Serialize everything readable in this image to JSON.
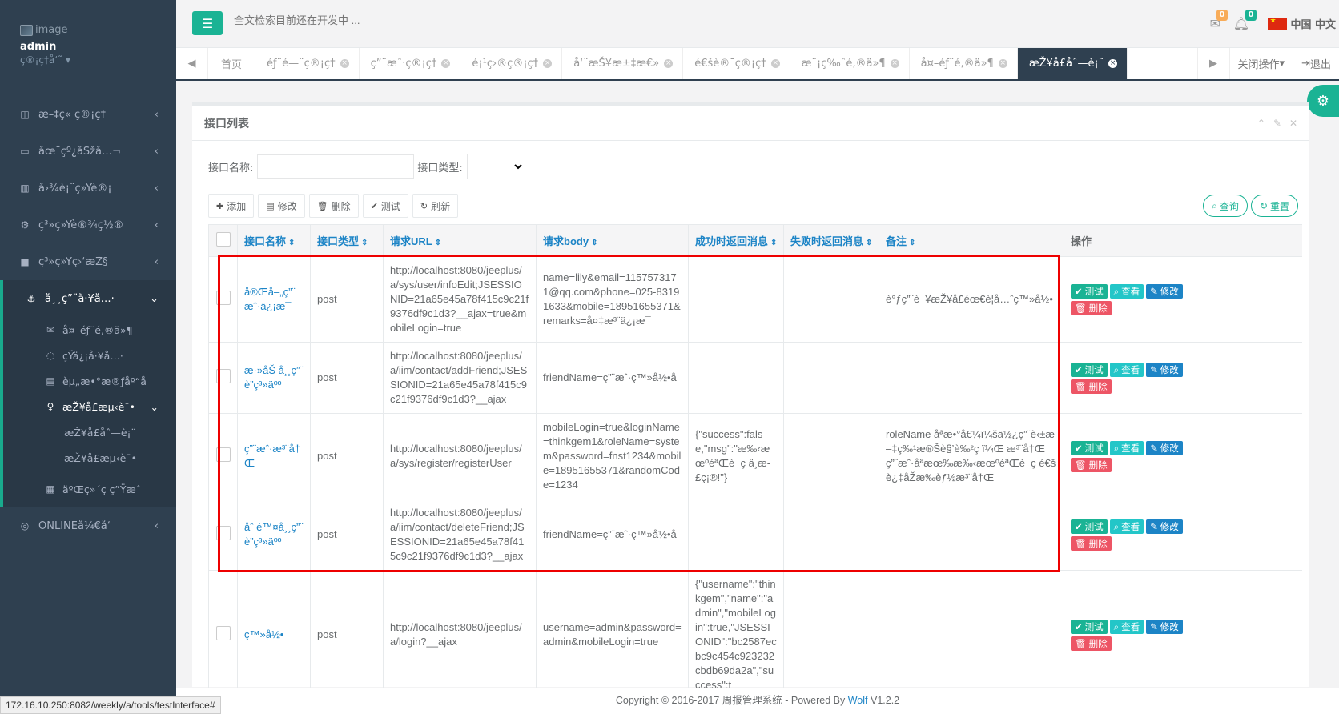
{
  "sidebar": {
    "profile": {
      "image_alt": "image",
      "name": "admin",
      "role": "ç®¡ç†å‘˜"
    },
    "items": [
      {
        "icon": "columns-icon",
        "glyph": "◫",
        "label": "æ–‡ç« ç®¡ç†"
      },
      {
        "icon": "desktop-icon",
        "glyph": "▭",
        "label": "åœ¨çº¿åŠžå…¬"
      },
      {
        "icon": "bar-chart-icon",
        "glyph": "▥",
        "label": "å›¾è¡¨ç»Ÿè®¡"
      },
      {
        "icon": "gear-icon",
        "glyph": "⚙",
        "label": "ç³»ç»Ÿè®¾ç½®"
      },
      {
        "icon": "video-icon",
        "glyph": "■",
        "label": "ç³»ç»Ÿç›‘æŽ§"
      }
    ],
    "open_group": {
      "icon": "anchor-icon",
      "glyph": "⚓",
      "label": "å¸¸ç”¨å·¥å…·",
      "children": [
        {
          "icon": "envelope-icon",
          "glyph": "✉",
          "label": "å¤–éƒ¨é‚®ä»¶"
        },
        {
          "icon": "comment-icon",
          "glyph": "◌",
          "label": "çŸ­ä¿¡å·¥å…·"
        },
        {
          "icon": "document-icon",
          "glyph": "▤",
          "label": "èµ„æ•°æ®ƒåº“å"
        }
      ],
      "active_child": {
        "icon": "lightbulb-icon",
        "glyph": "♀",
        "label": "æŽ¥å£æµ‹è¯•",
        "children": [
          {
            "label": "æŽ¥å£åˆ—è¡¨"
          },
          {
            "label": "æŽ¥å£æµ‹è¯•"
          }
        ]
      },
      "after": {
        "icon": "qrcode-icon",
        "glyph": "▦",
        "label": "äºŒç»´ç ç”Ÿæˆ"
      }
    },
    "bottom": {
      "icon": "gauge-icon",
      "glyph": "◎",
      "label": "ONLINEå¼€å‘"
    }
  },
  "header": {
    "search_placeholder": "全文检索目前还在开发中 ...",
    "mail_badge": "0",
    "bell_badge": "0",
    "lang": "中国 中文"
  },
  "tabs": {
    "home": "首页",
    "items": [
      "éƒ¨é—¨ç®¡ç†",
      "ç”¨æˆ·ç®¡ç†",
      "é¡¹ç›®ç®¡ç†",
      "å‘¨æŠ¥æ±‡æ€»",
      "é€šè®¯ç®¡ç†",
      "æ¨¡ç‰ˆé‚®ä»¶",
      "å¤–éƒ¨é‚®ä»¶",
      "æŽ¥å£åˆ—è¡¨"
    ],
    "active_index": 7,
    "close_ops": "关闭操作",
    "logout": "退出"
  },
  "panel": {
    "title": "接口列表",
    "filter_name_label": "接口名称:",
    "filter_type_label": "接口类型:",
    "toolbar": {
      "add": "添加",
      "edit": "修改",
      "delete": "删除",
      "test": "测试",
      "refresh": "刷新"
    },
    "query": "查询",
    "reset": "重置"
  },
  "table": {
    "columns": [
      "接口名称",
      "接口类型",
      "请求URL",
      "请求body",
      "成功时返回消息",
      "失败时返回消息",
      "备注",
      "操作"
    ],
    "op_labels": {
      "test": "测试",
      "view": "查看",
      "edit": "修改",
      "delete": "删除"
    },
    "rows": [
      {
        "name": "å®Œå–„ç”¨æˆ·ä¿¡æ¯",
        "type": "post",
        "url": "http://localhost:8080/jeeplus/a/sys/user/infoEdit;JSESSIONID=21a65e45a78f415c9c21f9376df9c1d3?__ajax=true&mobileLogin=true",
        "body": "name=lily&email=1157573171@qq.com&phone=025-83191633&mobile=18951655371&remarks=å¤‡æ³¨ä¿¡æ¯",
        "success": "",
        "fail": "",
        "remark": "è°ƒç”¨è¯¥æŽ¥å£éœ€è¦å…ˆç™»å½•"
      },
      {
        "name": "æ·»åŠ å¸¸ç”¨è”ç³»äºº",
        "type": "post",
        "url": "http://localhost:8080/jeeplus/a/iim/contact/addFriend;JSESSIONID=21a65e45a78f415c9c21f9376df9c1d3?__ajax",
        "body": "friendName=ç”¨æˆ·ç™»å½•å",
        "success": "",
        "fail": "",
        "remark": ""
      },
      {
        "name": "ç”¨æˆ·æ³¨å†Œ",
        "type": "post",
        "url": "http://localhost:8080/jeeplus/a/sys/register/registerUser",
        "body": "mobileLogin=true&loginName=thinkgem1&roleName=system&password=fnst1234&mobile=18951655371&randomCode=1234",
        "success": "{\"success\":false,\"msg\":\"æ‰‹æœºéªŒè¯ç ä¸æ­£ç¡®!\"}",
        "fail": "",
        "remark": "roleName åªæ•°å€¼ï¼šä½¿ç”¨è‹±æ–‡ç‰¹æ®Šè§’è‰²ç ï¼Œ æ³¨å†Œç”¨æˆ·åªæœ‰æ‰‹æœºéªŒè¯ç é€šè¿‡åŽæ‰èƒ½æ³¨å†Œ"
      },
      {
        "name": "åˆ é™¤å¸¸ç”¨è”ç³»äºº",
        "type": "post",
        "url": "http://localhost:8080/jeeplus/a/iim/contact/deleteFriend;JSESSIONID=21a65e45a78f415c9c21f9376df9c1d3?__ajax",
        "body": "friendName=ç”¨æˆ·ç™»å½•å",
        "success": "",
        "fail": "",
        "remark": ""
      },
      {
        "name": "ç™»å½•",
        "type": "post",
        "url": "http://localhost:8080/jeeplus/a/login?__ajax",
        "body": "username=admin&password=admin&mobileLogin=true",
        "success": "{\"username\":\"thinkgem\",\"name\":\"admin\",\"mobileLogin\":true,\"JSESSIONID\":\"bc2587ecbc9c454c923232cbdb69da2a\",\"success\":t",
        "fail": "",
        "remark": ""
      }
    ]
  },
  "footer": {
    "copyright": "Copyright © 2016-2017 周报管理系统 - Powered By ",
    "brand": "Wolf",
    "version": " V1.2.2"
  },
  "status_url": "172.16.10.250:8082/weekly/a/tools/testInterface#",
  "colors": {
    "accent": "#1ab394",
    "sidebar": "#2f4050",
    "link": "#1c84c6",
    "danger": "#ed5565",
    "highlight_box": "#e00000"
  }
}
